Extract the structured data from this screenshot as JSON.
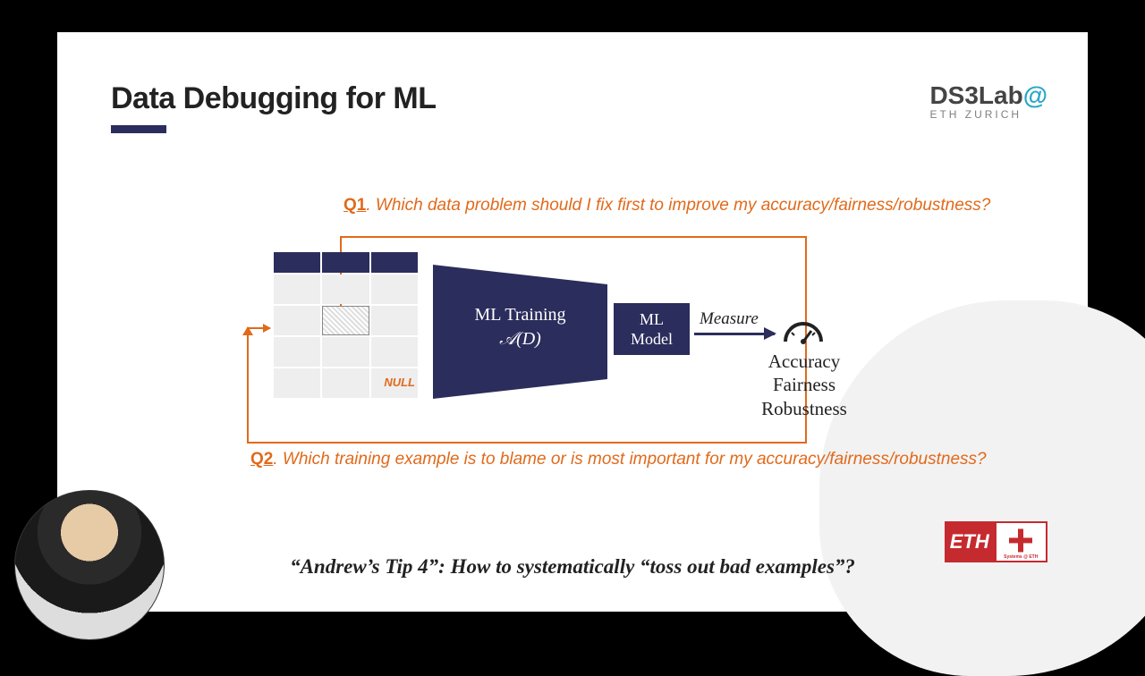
{
  "title": "Data Debugging for ML",
  "logo": {
    "line1a": "DS3Lab",
    "at": "@",
    "line2": "ETH ZURICH"
  },
  "q1": {
    "label": "Q1",
    "text": ". Which data problem should I fix first to improve my accuracy/fairness/robustness?"
  },
  "q2": {
    "label": "Q2",
    "text": ". Which training example is to blame or is most important for my accuracy/fairness/robustness?"
  },
  "table": {
    "null_label": "NULL"
  },
  "training": {
    "line1": "ML Training",
    "line2": "𝒜(D)"
  },
  "model": "ML\nModel",
  "measure": "Measure",
  "metrics": {
    "m1": "Accuracy",
    "m2": "Fairness",
    "m3": "Robustness"
  },
  "tip": "“Andrew’s Tip 4”: How to systematically “toss out bad examples”?",
  "eth": {
    "left": "ETH",
    "sub": "Systems @ ETH"
  }
}
